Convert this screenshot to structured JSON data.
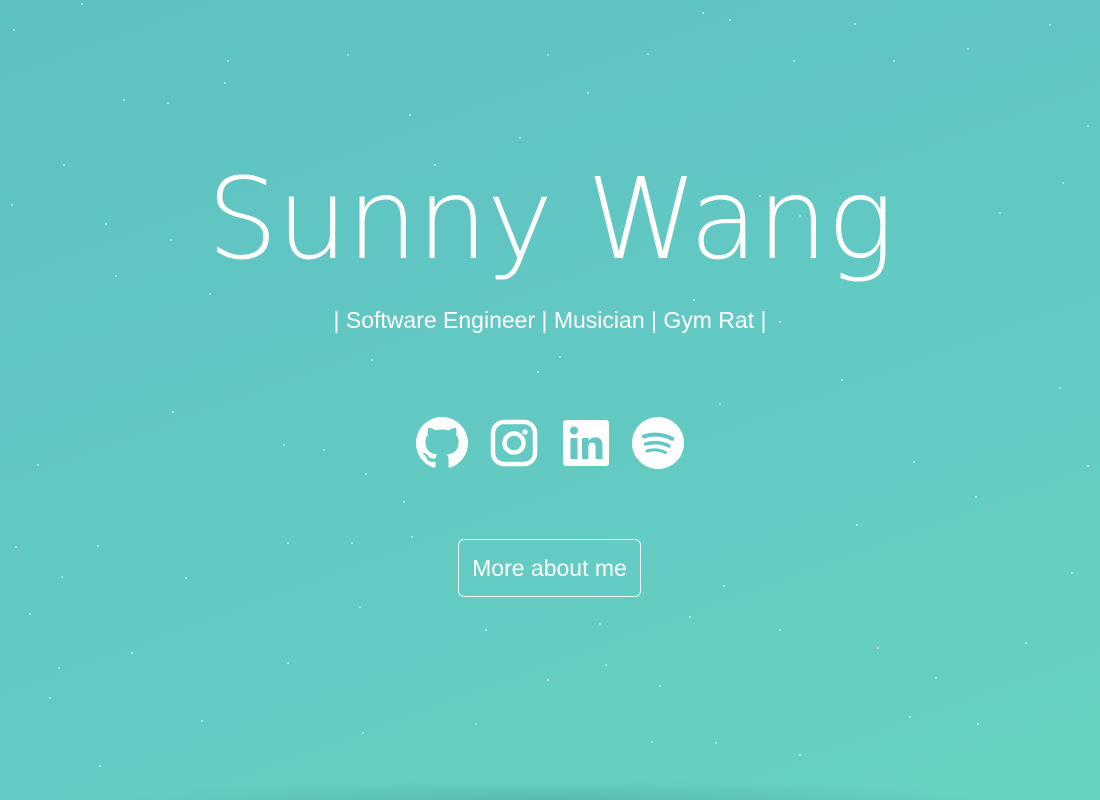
{
  "hero": {
    "name": "Sunny Wang",
    "tagline": "| Software Engineer | Musician | Gym Rat |",
    "cta_label": "More about me"
  },
  "socials": [
    {
      "icon": "github-icon",
      "label": "GitHub"
    },
    {
      "icon": "instagram-icon",
      "label": "Instagram"
    },
    {
      "icon": "linkedin-icon",
      "label": "LinkedIn"
    },
    {
      "icon": "spotify-icon",
      "label": "Spotify"
    }
  ],
  "colors": {
    "background_start": "#5ec1c3",
    "background_end": "#66d3c0",
    "foreground": "#ffffff"
  }
}
